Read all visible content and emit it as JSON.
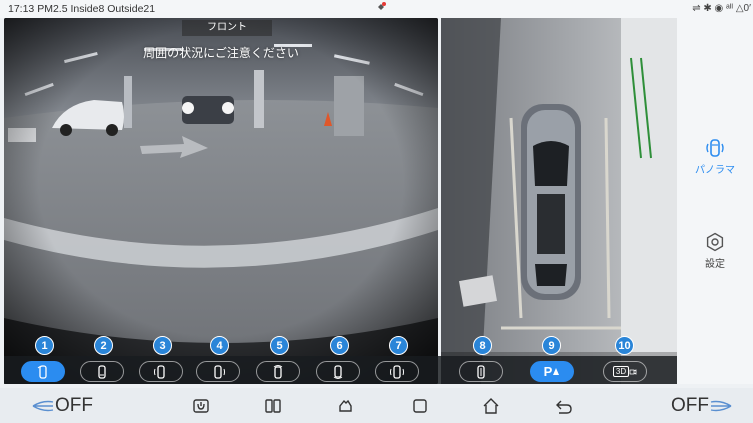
{
  "status_bar": {
    "time": "17:13",
    "info": "PM2.5 Inside8 Outside21",
    "right_icons": "⇌ ✱ ◉ ᵃᴵᴵ △0′"
  },
  "front_view": {
    "title": "フロント",
    "warning": "周囲の状況にご注意ください"
  },
  "right_panel": {
    "panorama_label": "パノラマ",
    "settings_label": "設定"
  },
  "camera_buttons": [
    {
      "number": "1",
      "active": true
    },
    {
      "number": "2",
      "active": false
    },
    {
      "number": "3",
      "active": false
    },
    {
      "number": "4",
      "active": false
    },
    {
      "number": "5",
      "active": false
    },
    {
      "number": "6",
      "active": false
    },
    {
      "number": "7",
      "active": false
    },
    {
      "number": "8",
      "active": false
    },
    {
      "number": "9",
      "active": false,
      "label": "P"
    },
    {
      "number": "10",
      "active": false,
      "label": "3D"
    }
  ],
  "bottom_nav": {
    "left_fan": "OFF",
    "right_fan": "OFF"
  },
  "colors": {
    "accent": "#2b8cf0",
    "badge": "#2a85d8",
    "nav_bg": "#e8ecf0"
  }
}
